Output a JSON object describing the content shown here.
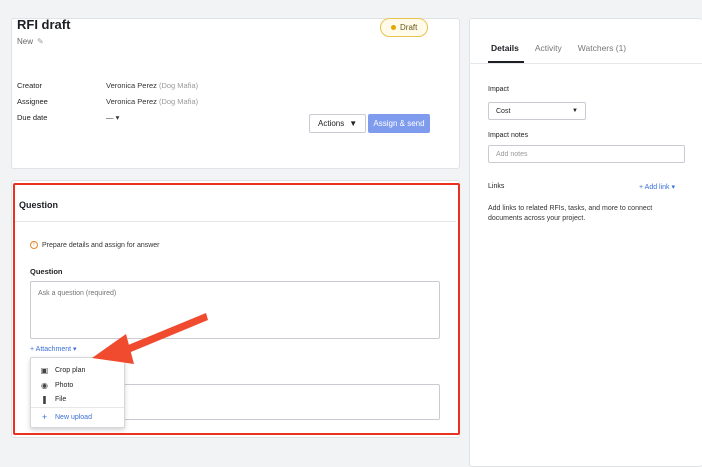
{
  "rfi": {
    "title": "RFI draft",
    "status": "New",
    "badge": "Draft",
    "meta": [
      {
        "label": "Creator",
        "name": "Veronica Perez",
        "org": "(Dog Mafia)"
      },
      {
        "label": "Assignee",
        "name": "Veronica Perez",
        "org": "(Dog Mafia)"
      },
      {
        "label": "Due date",
        "name": "—  ▾",
        "org": ""
      }
    ],
    "actions_label": "Actions",
    "assign_label": "Assign & send"
  },
  "question": {
    "heading": "Question",
    "hint": "Prepare details and assign for answer",
    "field_label": "Question",
    "field_placeholder": "Ask a question (required)",
    "attachment_label": "+ Attachment  ▾",
    "dropdown": [
      {
        "label": "Crop plan",
        "icon": "crop-plan-icon"
      },
      {
        "label": "Photo",
        "icon": "camera-icon"
      },
      {
        "label": "File",
        "icon": "paperclip-icon"
      },
      {
        "label": "New upload",
        "icon": "plus-icon"
      }
    ]
  },
  "details": {
    "tabs": [
      "Details",
      "Activity",
      "Watchers (1)"
    ],
    "impact_label": "Impact",
    "impact_value": "Cost",
    "impact_notes_label": "Impact notes",
    "impact_notes_placeholder": "Add notes",
    "links_label": "Links",
    "add_link_label": "+ Add link  ▾",
    "links_help": "Add links to related RFIs, tasks, and more to connect documents across your project."
  },
  "colors": {
    "accent": "#3b6fd6",
    "primary_button": "#7f9bee",
    "highlight_frame": "#e8311f",
    "arrow": "#f04a2f",
    "draft_border": "#e7c34d"
  }
}
